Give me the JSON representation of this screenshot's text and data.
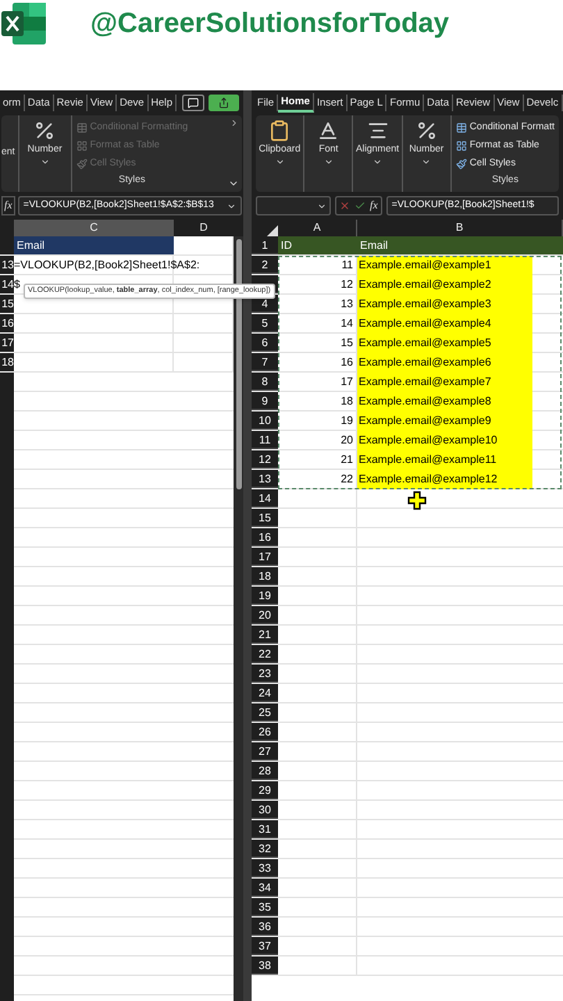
{
  "header": {
    "handle": "@CareerSolutionsforToday"
  },
  "left_window": {
    "tabs": [
      {
        "label": "orm",
        "selected": false
      },
      {
        "label": "Data",
        "selected": false
      },
      {
        "label": "Revie",
        "selected": false
      },
      {
        "label": "View",
        "selected": false
      },
      {
        "label": "Deve",
        "selected": false
      },
      {
        "label": "Help",
        "selected": false
      }
    ],
    "ribbon": {
      "groups": [
        {
          "kind": "cut",
          "label": "ent"
        },
        {
          "kind": "number",
          "label": "Number"
        }
      ],
      "styles": [
        {
          "label": "Conditional Formatting",
          "disabled": true
        },
        {
          "label": "Format as Table",
          "disabled": true
        },
        {
          "label": "Cell Styles",
          "disabled": true
        }
      ],
      "styles_label": "Styles"
    },
    "fx": "fx",
    "formula": "=VLOOKUP(B2,[Book2]Sheet1!$A$2:$B$13",
    "columns": [
      {
        "label": "C",
        "selected": true
      },
      {
        "label": "D",
        "selected": false
      }
    ],
    "rows": [
      {
        "kind": "header",
        "cells": [
          "Email",
          ""
        ]
      },
      {
        "number": "13",
        "cells": [
          "=VLOOKUP(B2,[Book2]Sheet1!$A$2:",
          ""
        ]
      },
      {
        "number": "14",
        "cells": [
          "$",
          ""
        ]
      },
      {
        "number": "15",
        "cells": [
          "",
          ""
        ]
      },
      {
        "number": "16",
        "cells": [
          "",
          ""
        ]
      },
      {
        "number": "17",
        "cells": [
          "",
          ""
        ]
      },
      {
        "number": "18",
        "cells": [
          "",
          ""
        ]
      }
    ],
    "tooltip": "VLOOKUP(lookup_value, **table_array**, col_index_num, [range_lookup])"
  },
  "right_window": {
    "tabs": [
      {
        "label": "File",
        "selected": false
      },
      {
        "label": "Home",
        "selected": true
      },
      {
        "label": "Insert",
        "selected": false
      },
      {
        "label": "Page L",
        "selected": false
      },
      {
        "label": "Formu",
        "selected": false
      },
      {
        "label": "Data",
        "selected": false
      },
      {
        "label": "Review",
        "selected": false
      },
      {
        "label": "View",
        "selected": false
      },
      {
        "label": "Develc",
        "selected": false
      }
    ],
    "ribbon": {
      "groups": [
        {
          "kind": "clipboard",
          "label": "Clipboard"
        },
        {
          "kind": "font",
          "label": "Font"
        },
        {
          "kind": "alignment",
          "label": "Alignment"
        },
        {
          "kind": "number",
          "label": "Number"
        }
      ],
      "styles": [
        {
          "label": "Conditional Formatt",
          "disabled": false
        },
        {
          "label": "Format as Table",
          "disabled": false
        },
        {
          "label": "Cell Styles",
          "disabled": false
        }
      ],
      "styles_label": "Styles"
    },
    "fx": "fx",
    "formula": "=VLOOKUP(B2,[Book2]Sheet1!$",
    "columns": [
      {
        "label": "A",
        "selected": false
      },
      {
        "label": "B",
        "selected": false
      }
    ],
    "copy_marquee": true,
    "rows": [
      {
        "number": "1",
        "kind": "header",
        "cells": [
          "ID",
          "Email"
        ]
      },
      {
        "number": "2",
        "cells": [
          "11",
          "Example.email@example1"
        ],
        "highlighted": true
      },
      {
        "cells": [
          "12",
          "Example.email@example2"
        ],
        "highlighted": true
      },
      {
        "number": "4",
        "cells": [
          "13",
          "Example.email@example3"
        ],
        "highlighted": true
      },
      {
        "number": "5",
        "cells": [
          "14",
          "Example.email@example4"
        ],
        "highlighted": true
      },
      {
        "number": "6",
        "cells": [
          "15",
          "Example.email@example5"
        ],
        "highlighted": true
      },
      {
        "number": "7",
        "cells": [
          "16",
          "Example.email@example6"
        ],
        "highlighted": true
      },
      {
        "number": "8",
        "cells": [
          "17",
          "Example.email@example7"
        ],
        "highlighted": true
      },
      {
        "number": "9",
        "cells": [
          "18",
          "Example.email@example8"
        ],
        "highlighted": true
      },
      {
        "number": "10",
        "cells": [
          "19",
          "Example.email@example9"
        ],
        "highlighted": true
      },
      {
        "number": "11",
        "cells": [
          "20",
          "Example.email@example10"
        ],
        "highlighted": true
      },
      {
        "number": "12",
        "cells": [
          "21",
          "Example.email@example11"
        ],
        "highlighted": true
      },
      {
        "number": "13",
        "cells": [
          "22",
          "Example.email@example12"
        ],
        "highlighted": true
      },
      {
        "number": "14",
        "cells": [
          "",
          ""
        ]
      },
      {
        "number": "15",
        "cells": [
          "",
          ""
        ]
      },
      {
        "number": "16",
        "cells": [
          "",
          ""
        ]
      },
      {
        "number": "17",
        "cells": [
          "",
          ""
        ]
      },
      {
        "number": "18",
        "cells": [
          "",
          ""
        ]
      },
      {
        "number": "19",
        "cells": [
          "",
          ""
        ]
      },
      {
        "number": "20",
        "cells": [
          "",
          ""
        ]
      },
      {
        "number": "21",
        "cells": [
          "",
          ""
        ]
      },
      {
        "number": "22",
        "cells": [
          "",
          ""
        ]
      },
      {
        "number": "23",
        "cells": [
          "",
          ""
        ]
      },
      {
        "number": "24",
        "cells": [
          "",
          ""
        ]
      },
      {
        "number": "25",
        "cells": [
          "",
          ""
        ]
      },
      {
        "number": "26",
        "cells": [
          "",
          ""
        ]
      },
      {
        "number": "27",
        "cells": [
          "",
          ""
        ]
      },
      {
        "number": "28",
        "cells": [
          "",
          ""
        ]
      },
      {
        "number": "29",
        "cells": [
          "",
          ""
        ]
      },
      {
        "number": "30",
        "cells": [
          "",
          ""
        ]
      },
      {
        "number": "31",
        "cells": [
          "",
          ""
        ]
      },
      {
        "number": "32",
        "cells": [
          "",
          ""
        ]
      },
      {
        "number": "33",
        "cells": [
          "",
          ""
        ]
      },
      {
        "number": "34",
        "cells": [
          "",
          ""
        ]
      },
      {
        "number": "35",
        "cells": [
          "",
          ""
        ]
      },
      {
        "number": "36",
        "cells": [
          "",
          ""
        ]
      },
      {
        "number": "37",
        "cells": [
          "",
          ""
        ]
      },
      {
        "number": "38",
        "cells": [
          "",
          ""
        ]
      }
    ]
  }
}
